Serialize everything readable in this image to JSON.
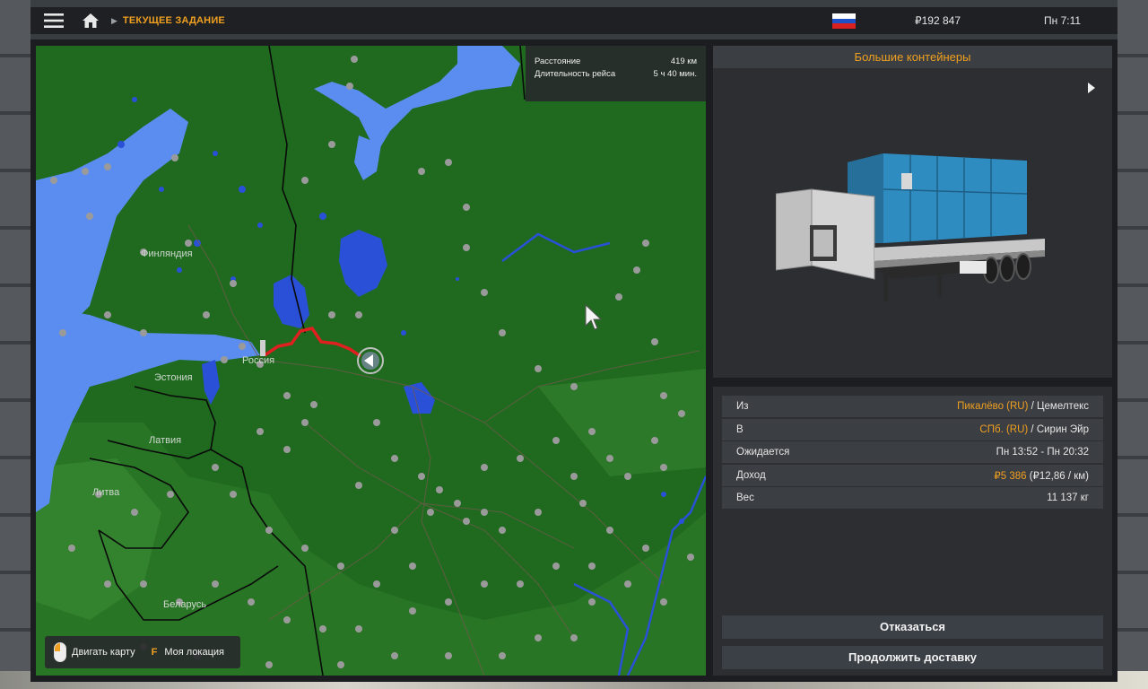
{
  "topbar": {
    "breadcrumb": "ТЕКУЩЕЕ ЗАДАНИЕ",
    "money": "₽192 847",
    "time": "Пн 7:11",
    "icons": [
      "menu-icon",
      "home-icon",
      "russia-flag-icon"
    ]
  },
  "map": {
    "info": {
      "distance_label": "Расстояние",
      "distance_value": "419 км",
      "duration_label": "Длительность рейса",
      "duration_value": "5 ч 40 мин."
    },
    "labels": {
      "finland": "Финляндия",
      "estonia": "Эстония",
      "russia": "Россия",
      "latvia": "Латвия",
      "lithuania": "Литва",
      "belarus": "Беларусь"
    },
    "legend": {
      "move_map": "Двигать карту",
      "key": "F",
      "my_location": "Моя локация"
    },
    "colors": {
      "land": "#1f6a1f",
      "water": "#5b8cf0",
      "route": "#e02020"
    }
  },
  "cargo": {
    "title": "Большие контейнеры"
  },
  "details": {
    "from_label": "Из",
    "from_city": "Пикалёво (RU)",
    "from_company": " / Цемелтекс",
    "to_label": "В",
    "to_city": "СПб. (RU)",
    "to_company": " / Сирин Эйр",
    "expected_label": "Ожидается",
    "expected_value": "Пн 13:52 - Пн 20:32",
    "income_label": "Доход",
    "income_value": "₽5 386",
    "income_rate": " (₽12,86 / км)",
    "weight_label": "Вес",
    "weight_value": "11 137 кг"
  },
  "buttons": {
    "cancel": "Отказаться",
    "continue": "Продолжить доставку"
  },
  "accent_color": "#f0a020"
}
